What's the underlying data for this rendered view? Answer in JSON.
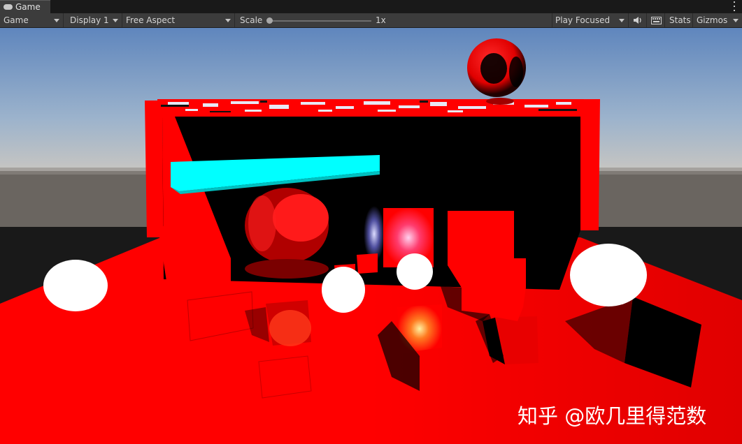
{
  "window": {
    "tab_label": "Game"
  },
  "toolbar": {
    "view_mode": "Game",
    "display": "Display 1",
    "aspect": "Free Aspect",
    "scale_label": "Scale",
    "scale_value": "1x",
    "play_mode": "Play Focused",
    "stats_label": "Stats",
    "gizmos_label": "Gizmos"
  },
  "watermark": {
    "text": "知乎 @欧几里得范数"
  },
  "colors": {
    "scene_red": "#ff0000",
    "cyan_bar": "#00ffff",
    "editor_bg": "#3c3c3c"
  }
}
